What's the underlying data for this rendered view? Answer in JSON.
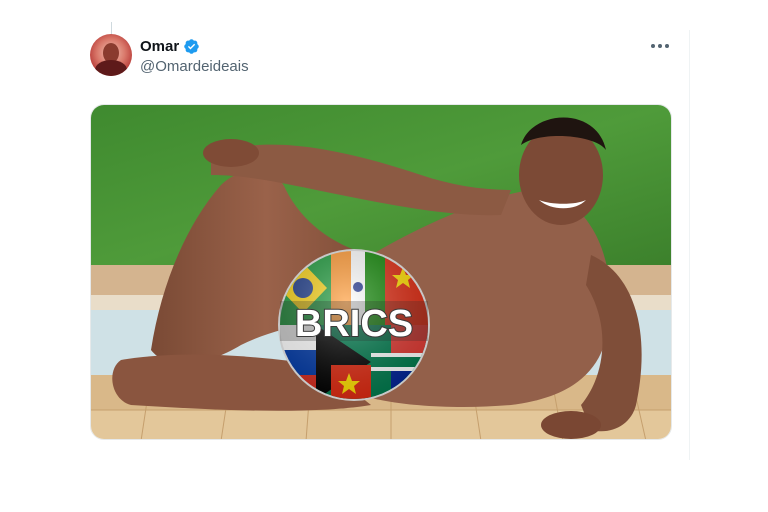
{
  "tweet": {
    "author": {
      "display_name": "Omar",
      "handle": "@Omardeideais",
      "verified": true,
      "verified_color": "#1d9bf0"
    },
    "more_icon": "more-horizontal-icon",
    "media": {
      "badge_text": "BRICS"
    }
  }
}
